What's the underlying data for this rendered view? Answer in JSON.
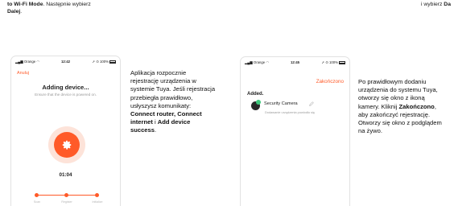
{
  "top_left": {
    "line1_bold": "to Wi-Fi Mode",
    "line1_rest": ". Następnie wybierz",
    "line2_bold": "Dalej",
    "line2_rest": "."
  },
  "top_right": {
    "line1": "",
    "line2_prefix": "i wybierz",
    "line2_bold": "Da"
  },
  "phone1": {
    "carrier": "Orange",
    "time": "12:42",
    "battery": "100%",
    "cancel": "Anuluj",
    "title": "Adding device...",
    "subtitle": "Ensure that the device is powered on.",
    "timer": "01:04",
    "steps": [
      "Scan",
      "Register",
      "Initialize"
    ],
    "accent": "#ff5a28",
    "center_icon": "gear-icon"
  },
  "desc1": {
    "p1": "Aplikacja rozpocznie rejestrację urządzenia w systemie Tuya. Jeśli rejestracja przebiegła prawidłowo, usłyszysz komunikaty: ",
    "b1": "Connect router, Connect internet",
    "p2": " i ",
    "b2": "Add device success",
    "p3": "."
  },
  "phone2": {
    "carrier": "Orange",
    "time": "12:45",
    "battery": "100%",
    "done": "Zakończono",
    "added": "Added.",
    "device_name": "Security Camera",
    "device_status": "Dodawanie urządzenia powiodło się",
    "device_icon": "camera-icon"
  },
  "desc2": {
    "p1": "Po prawidłowym dodaniu urządzenia do systemu Tuya, otworzy się okno z ikoną kamery. Kliknij ",
    "b1": "Zakończono",
    "p2": ", aby zakończyć rejestrację. Otworzy się okno z podglądem na żywo."
  }
}
